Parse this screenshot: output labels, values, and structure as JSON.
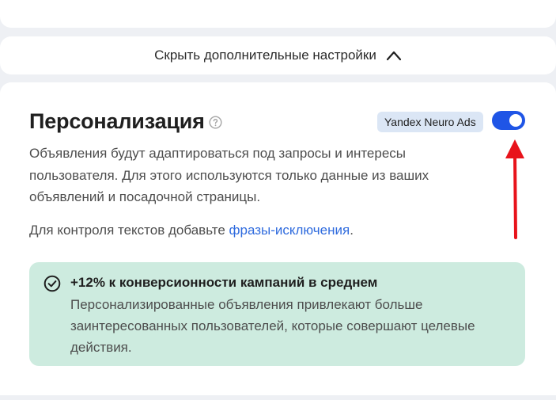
{
  "advanced": {
    "hide_label": "Скрыть дополнительные настройки",
    "chevron_icon": "chevron-up-icon"
  },
  "personalization": {
    "title": "Персонализация",
    "help_icon": "question-circle-icon",
    "badge": "Yandex Neuro Ads",
    "toggle": {
      "state": "on",
      "color": "#1f55e6"
    },
    "description": "Объявления будут адаптироваться под запросы и интересы пользователя. Для этого используются только данные из ваших объявлений и посадочной страницы.",
    "hint_prefix": "Для контроля текстов добавьте ",
    "hint_link": "фразы-исключения",
    "hint_suffix": "."
  },
  "annotation": {
    "arrow_color": "#e8131b"
  },
  "info": {
    "icon": "check-circle-icon",
    "title": "+12% к конверсионности кампаний в среднем",
    "text": "Персонализированные объявления привлекают больше заинтересованных пользователей, которые совершают целевые действия.",
    "background": "#cdebdf"
  }
}
